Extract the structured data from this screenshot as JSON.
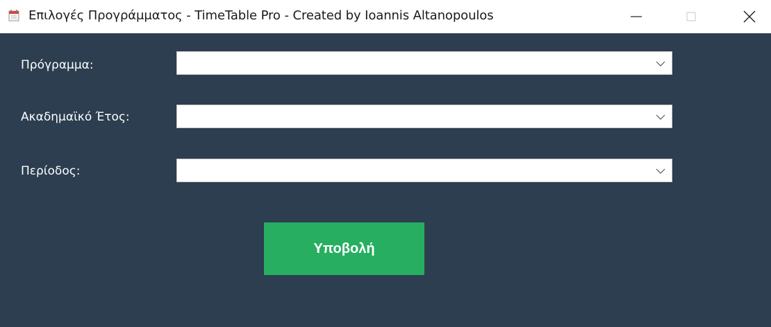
{
  "window": {
    "title": "Επιλογές Προγράμματος - TimeTable Pro - Created by Ioannis Altanopoulos",
    "icon": "calendar-app-icon",
    "controls": {
      "minimize_icon": "minimize-icon",
      "maximize_icon": "maximize-icon",
      "close_icon": "close-icon"
    }
  },
  "form": {
    "fields": [
      {
        "label": "Πρόγραμμα:",
        "value": ""
      },
      {
        "label": "Ακαδημαϊκό Έτος:",
        "value": ""
      },
      {
        "label": "Περίοδος:",
        "value": ""
      }
    ],
    "submit_label": "Υποβολή"
  },
  "colors": {
    "background": "#2c3e50",
    "submit_button": "#27ae60",
    "titlebar": "#ffffff"
  }
}
